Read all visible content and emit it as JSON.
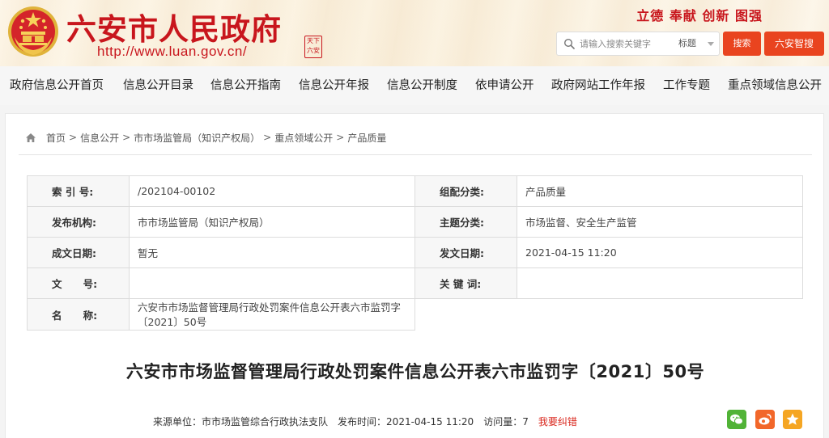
{
  "header": {
    "site_title": "六安市人民政府",
    "site_url": "http://www.luan.gov.cn/",
    "stamp_text": "天下 六安",
    "slogan": "立德  奉献  创新  图强",
    "search": {
      "placeholder": "请输入搜索关键字",
      "scope": "标题",
      "search_label": "搜索",
      "smart_label": "六安智搜"
    }
  },
  "nav": {
    "items": [
      "政府信息公开首页",
      "信息公开目录",
      "信息公开指南",
      "信息公开年报",
      "信息公开制度",
      "依申请公开",
      "政府网站工作年报",
      "工作专题",
      "重点领域信息公开"
    ]
  },
  "breadcrumb": {
    "items": [
      "首页",
      "信息公开",
      "市市场监管局（知识产权局）",
      "重点领域公开",
      "产品质量"
    ],
    "sep": ">"
  },
  "meta": {
    "index_label": "索 引 号:",
    "index_value": "/202104-00102",
    "category_label": "组配分类:",
    "category_value": "产品质量",
    "publisher_label": "发布机构:",
    "publisher_value": "市市场监管局（知识产权局）",
    "topic_label": "主题分类:",
    "topic_value": "市场监督、安全生产监管",
    "created_label": "成文日期:",
    "created_value": "暂无",
    "published_label": "发文日期:",
    "published_value": "2021-04-15 11:20",
    "docno_label": "文      号:",
    "docno_value": "",
    "keywords_label": "关 键 词:",
    "keywords_value": "",
    "name_label": "名      称:",
    "name_value": "六安市市场监督管理局行政处罚案件信息公开表六市监罚字〔2021〕50号"
  },
  "document": {
    "title": "六安市市场监督管理局行政处罚案件信息公开表六市监罚字〔2021〕50号",
    "source_label": "来源单位：",
    "source_value": "市市场监管综合行政执法支队",
    "date_label": "发布时间：",
    "date_value": "2021-04-15 11:20",
    "views_label": "访问量：",
    "views_value": "7",
    "error_link": "我要纠错"
  },
  "colors": {
    "brand_red": "#c8161d",
    "button_orange": "#e9441f",
    "wechat_green": "#51b337",
    "weibo_orange": "#f2672a",
    "favorite_yellow": "#f5a623"
  },
  "icons": [
    "national-emblem-icon",
    "search-icon",
    "home-icon",
    "wechat-icon",
    "weibo-icon",
    "favorite-star-icon"
  ]
}
